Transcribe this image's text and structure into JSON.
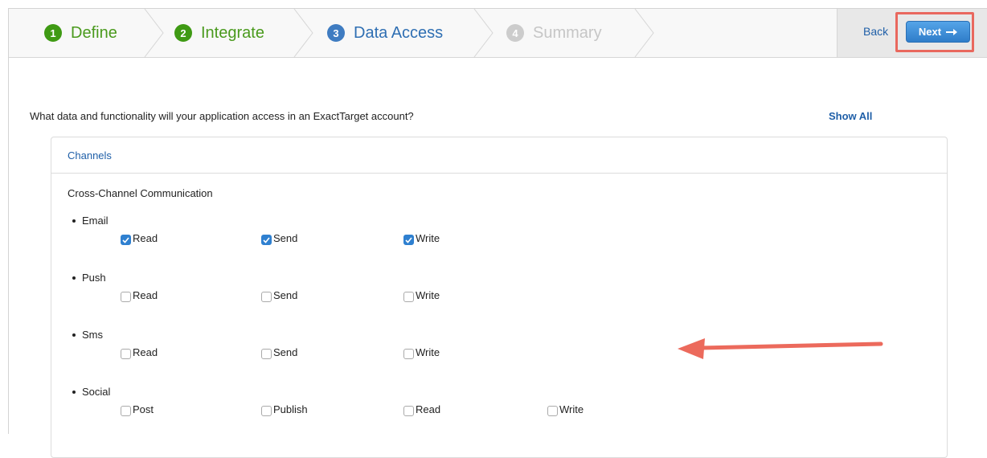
{
  "wizard": {
    "steps": [
      {
        "num": "1",
        "label": "Define",
        "state": "done"
      },
      {
        "num": "2",
        "label": "Integrate",
        "state": "done"
      },
      {
        "num": "3",
        "label": "Data Access",
        "state": "active"
      },
      {
        "num": "4",
        "label": "Summary",
        "state": "todo"
      }
    ],
    "back_label": "Back",
    "next_label": "Next"
  },
  "question": "What data and functionality will your application access in an ExactTarget account?",
  "show_all_label": "Show All",
  "panel": {
    "title": "Channels",
    "section": "Cross-Channel Communication",
    "groups": [
      {
        "name": "Email",
        "options": [
          {
            "label": "Read",
            "checked": true
          },
          {
            "label": "Send",
            "checked": true
          },
          {
            "label": "Write",
            "checked": true
          }
        ]
      },
      {
        "name": "Push",
        "options": [
          {
            "label": "Read",
            "checked": false
          },
          {
            "label": "Send",
            "checked": false
          },
          {
            "label": "Write",
            "checked": false
          }
        ]
      },
      {
        "name": "Sms",
        "options": [
          {
            "label": "Read",
            "checked": false
          },
          {
            "label": "Send",
            "checked": false
          },
          {
            "label": "Write",
            "checked": false
          }
        ]
      },
      {
        "name": "Social",
        "options": [
          {
            "label": "Post",
            "checked": false
          },
          {
            "label": "Publish",
            "checked": false
          },
          {
            "label": "Read",
            "checked": false
          },
          {
            "label": "Write",
            "checked": false
          }
        ]
      }
    ]
  },
  "colors": {
    "done": "#3f9a14",
    "active": "#3f7cc1",
    "todo": "#cccccc",
    "highlight": "#e9685e"
  }
}
